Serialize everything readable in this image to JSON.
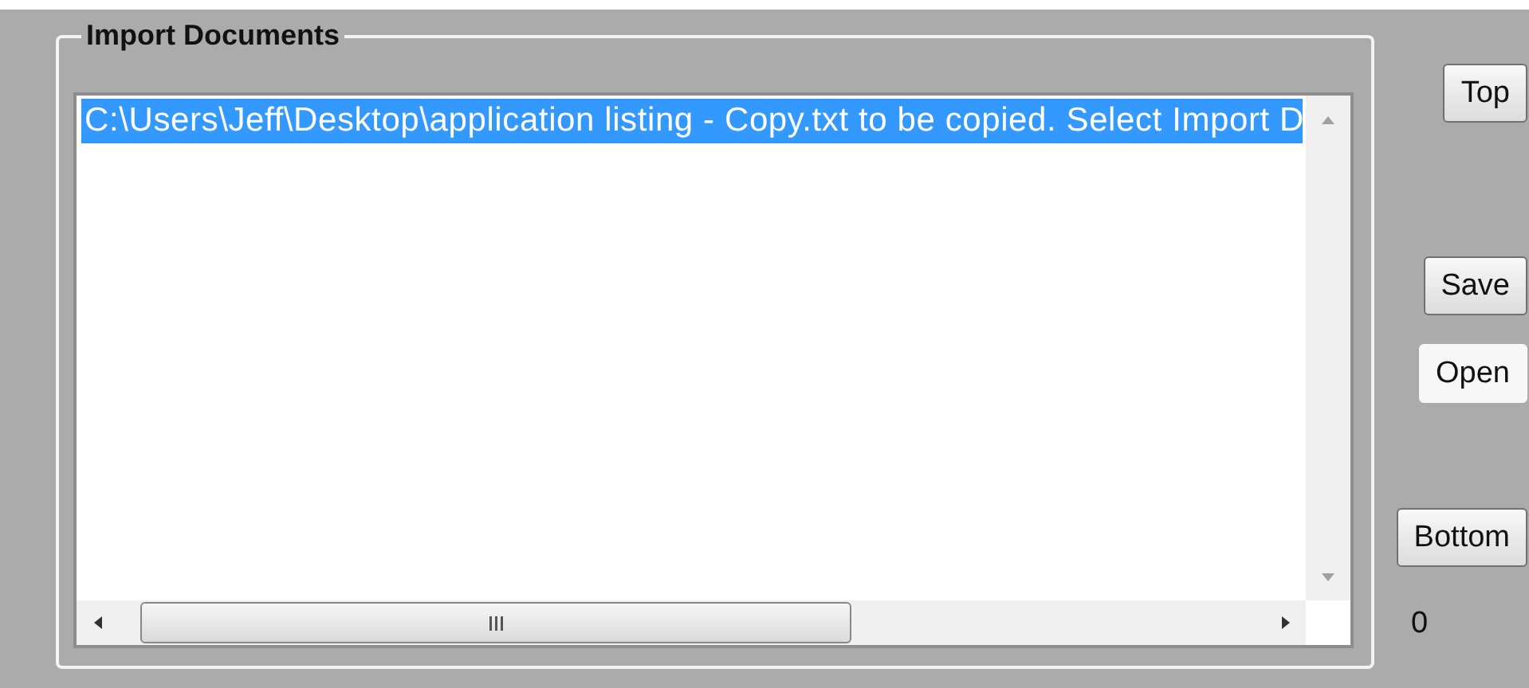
{
  "group": {
    "title": "Import Documents"
  },
  "list": {
    "items": [
      {
        "text": "C:\\Users\\Jeff\\Desktop\\application listing - Copy.txt to be copied. Select Import D",
        "selected": true
      }
    ]
  },
  "buttons": [
    {
      "label": "Top",
      "kind": "raised"
    },
    {
      "label": "Save",
      "kind": "raised"
    },
    {
      "label": "Open",
      "kind": "flat"
    },
    {
      "label": "Bottom",
      "kind": "raised"
    }
  ],
  "count": "0"
}
